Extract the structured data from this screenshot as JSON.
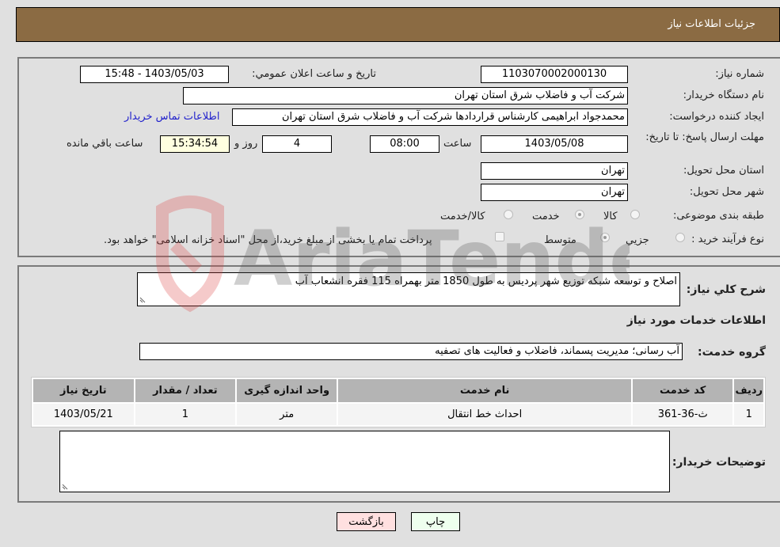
{
  "header": {
    "title": "جزئیات اطلاعات نیاز"
  },
  "form": {
    "need_number": {
      "label": "شماره نیاز:",
      "value": "1103070002000130"
    },
    "announce_datetime": {
      "label": "تاریخ و ساعت اعلان عمومي:",
      "value": "1403/05/03 - 15:48"
    },
    "buyer_org": {
      "label": "نام دستگاه خریدار:",
      "value": "شرکت آب و فاضلاب شرق استان تهران"
    },
    "requester": {
      "label": "ایجاد کننده درخواست:",
      "value": "محمدجواد ابراهیمی کارشناس قراردادها شرکت آب و فاضلاب شرق استان تهران"
    },
    "buyer_contact_link": "اطلاعات تماس خریدار",
    "deadline": {
      "label": "مهلت ارسال پاسخ: تا تاریخ:",
      "date": "1403/05/08",
      "time_label": "ساعت",
      "time": "08:00",
      "days": "4",
      "days_label": "روز و",
      "remaining": "15:34:54",
      "remaining_label": "ساعت باقي مانده"
    },
    "delivery_province": {
      "label": "استان محل تحویل:",
      "value": "تهران"
    },
    "delivery_city": {
      "label": "شهر محل تحویل:",
      "value": "تهران"
    },
    "subject_category": {
      "label": "طبقه بندی موضوعی:",
      "options": [
        "کالا",
        "خدمت",
        "کالا/خدمت"
      ],
      "selected": "خدمت"
    },
    "purchase_process": {
      "label": "نوع فرآیند خرید :",
      "options": [
        "جزيي",
        "متوسط"
      ],
      "selected": "متوسط",
      "treasury_checkbox_label": "پرداخت تمام یا بخشی از مبلغ خرید،از محل \"اسناد خزانه اسلامی\" خواهد بود.",
      "treasury_checked": false
    }
  },
  "details": {
    "description_label": "شرح کلي نیاز:",
    "description": "اصلاح و توسعه شبکه توزیع شهر پردیس به طول 1850 متر بهمراه 115 فقره انشعاب آب",
    "services_heading": "اطلاعات خدمات مورد نیاز",
    "service_group_label": "گروه خدمت:",
    "service_group": "آب رسانی؛ مدیریت پسماند، فاضلاب و فعالیت های تصفیه",
    "table": {
      "headers": [
        "ردیف",
        "کد خدمت",
        "نام خدمت",
        "واحد اندازه گیری",
        "تعداد / مقدار",
        "تاریخ نیاز"
      ],
      "rows": [
        [
          "1",
          "ث-36-361",
          "احداث خط انتقال",
          "متر",
          "1",
          "1403/05/21"
        ]
      ]
    },
    "buyer_notes_label": "توضیحات خریدار:",
    "buyer_notes": ""
  },
  "buttons": {
    "print": "چاپ",
    "back": "بازگشت"
  },
  "watermark": {
    "text": "AriaTender.neT"
  },
  "colors": {
    "header_bg": "#8b6b43",
    "print_bg": "#eeffee",
    "back_bg": "#ffe0e0",
    "link": "#2222cc"
  }
}
